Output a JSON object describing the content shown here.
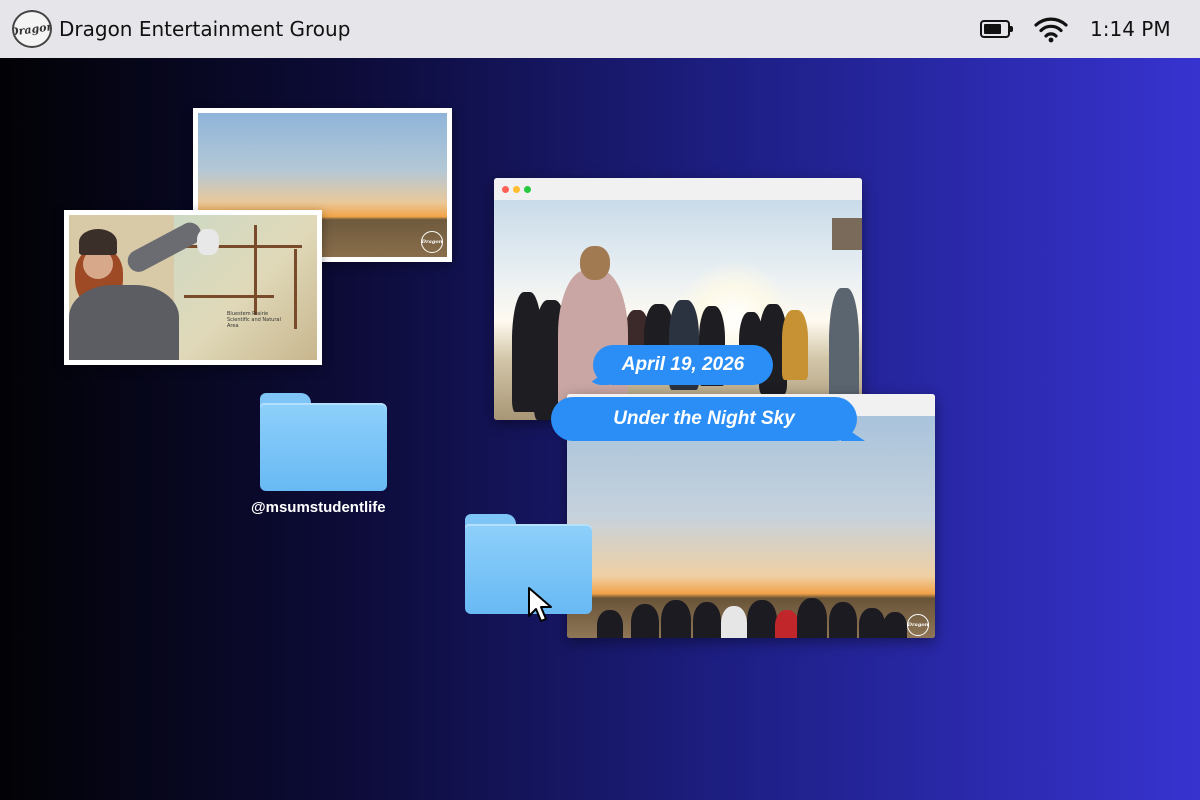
{
  "menubar": {
    "logo_text": "Dragon",
    "app_title": "Dragon Entertainment Group",
    "battery_level": 0.75,
    "clock": "1:14 PM",
    "icons": [
      "battery-icon",
      "wifi-icon"
    ]
  },
  "photos": {
    "map_caption": "Bluestem Prairie Scientific and Natural Area",
    "watermark_text": "Dragon"
  },
  "folder_label": "@msumstudentlife",
  "bubbles": {
    "date": "April 19, 2026",
    "title": "Under the Night Sky"
  },
  "colors": {
    "bubble": "#2a8ef6",
    "folder": "#7fc4f7",
    "window_dot_red": "#ff5f57",
    "window_dot_yellow": "#febc2e",
    "window_dot_green": "#28c840"
  }
}
